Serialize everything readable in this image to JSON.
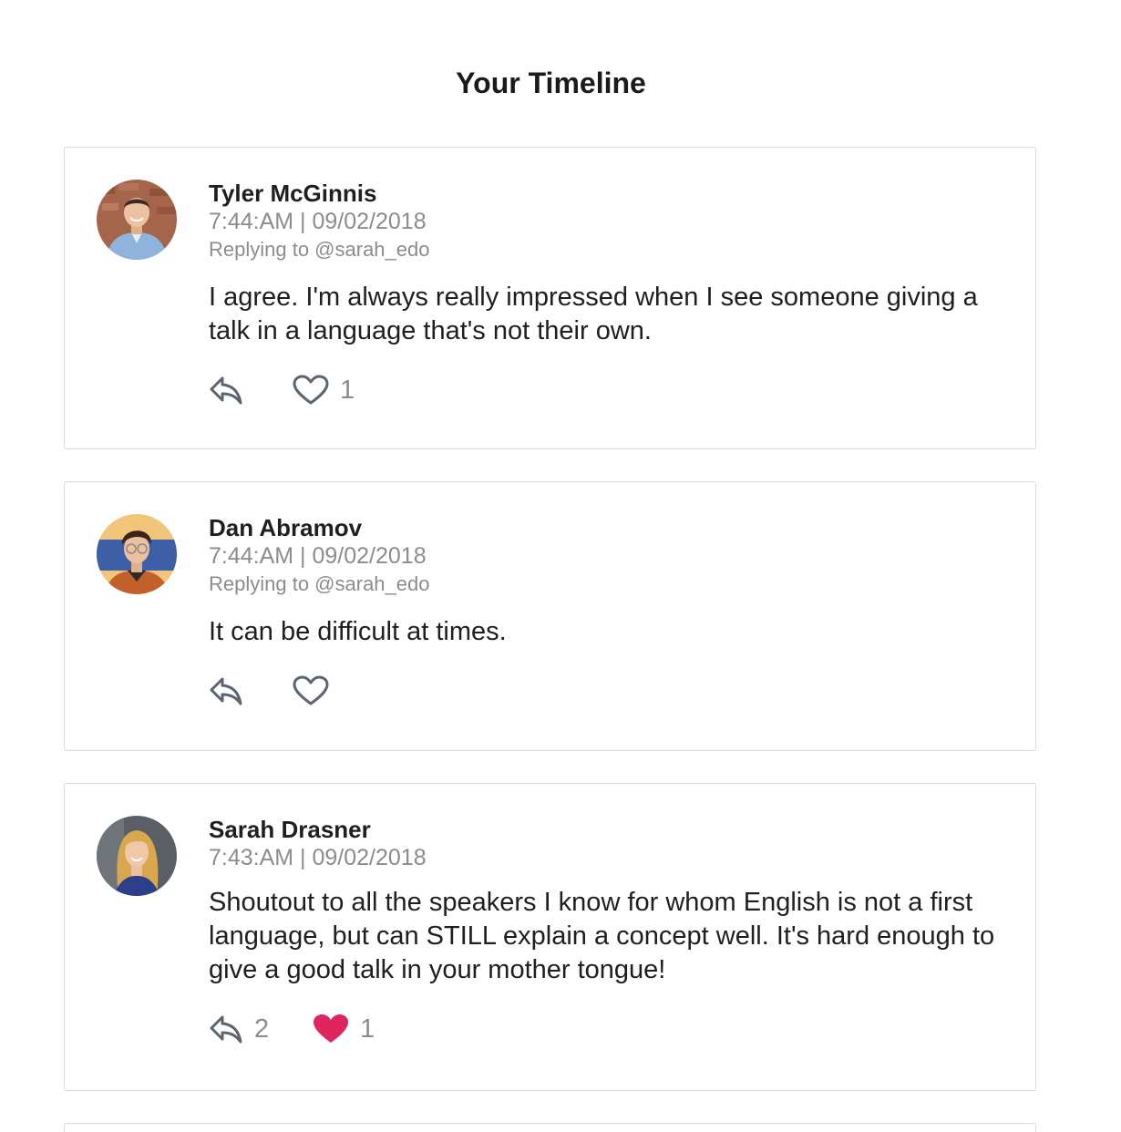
{
  "page": {
    "title": "Your Timeline"
  },
  "colors": {
    "accent_like": "#e0245e",
    "icon": "#5b6470",
    "muted_text": "#8c8c8c",
    "border": "#dadada"
  },
  "tweets": [
    {
      "author": "Tyler McGinnis",
      "timestamp": "7:44:AM | 09/02/2018",
      "replying_to": "Replying to @sarah_edo",
      "text": "I agree. I'm always really impressed when I see someone giving a talk in a language that's not their own.",
      "reply_count": "",
      "like_count": "1",
      "liked": false,
      "icons": {
        "reply": "reply-icon",
        "like": "heart-outline-icon"
      }
    },
    {
      "author": "Dan Abramov",
      "timestamp": "7:44:AM | 09/02/2018",
      "replying_to": "Replying to @sarah_edo",
      "text": "It can be difficult at times.",
      "reply_count": "",
      "like_count": "",
      "liked": false,
      "icons": {
        "reply": "reply-icon",
        "like": "heart-outline-icon"
      }
    },
    {
      "author": "Sarah Drasner",
      "timestamp": "7:43:AM | 09/02/2018",
      "replying_to": "",
      "text": "Shoutout to all the speakers I know for whom English is not a first language, but can STILL explain a concept well. It's hard enough to give a good talk in your mother tongue!",
      "reply_count": "2",
      "like_count": "1",
      "liked": true,
      "icons": {
        "reply": "reply-icon",
        "like": "heart-filled-icon"
      }
    }
  ]
}
